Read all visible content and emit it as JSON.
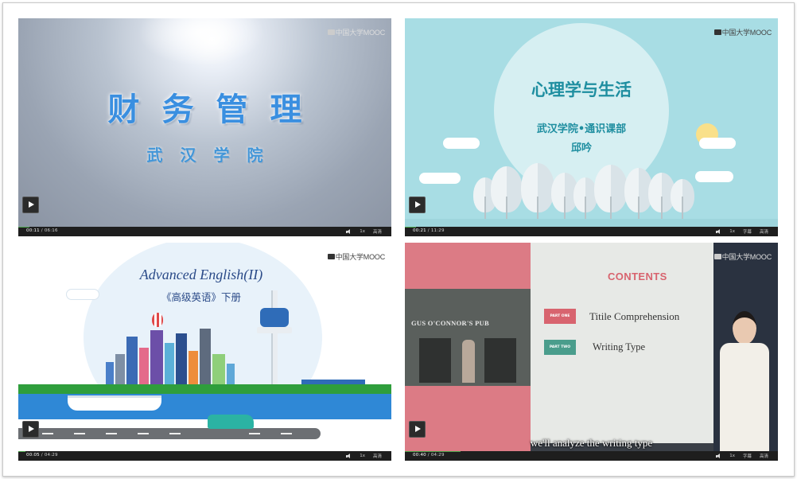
{
  "brand": "中国大学MOOC",
  "players": [
    {
      "title": "财务管理",
      "subtitle": "武汉学院",
      "current_time": "00:11",
      "duration": "06:16",
      "speed": "1x",
      "quality": "高清",
      "progress": 0.03
    },
    {
      "title": "心理学与生活",
      "subtitle": "武汉学院•通识课部",
      "lecturer": "邱吟",
      "current_time": "00:21",
      "duration": "11:29",
      "speed": "1x",
      "captions": "字幕",
      "quality": "高清",
      "progress": 0.03
    },
    {
      "title": "Advanced English(II)",
      "subtitle": "《高级英语》下册",
      "current_time": "00:05",
      "duration": "04:29",
      "speed": "1x",
      "quality": "高清",
      "progress": 0.02
    },
    {
      "slide_heading": "CONTENTS",
      "parts": [
        {
          "tag": "PART ONE",
          "text": "Titile Comprehension",
          "color": "#d8646f"
        },
        {
          "tag": "PART TWO",
          "text": "Writing Type",
          "color": "#4a9d8c"
        }
      ],
      "pub_sign": "GUS O'CONNOR'S PUB",
      "caption": "we'll analyze the writing type",
      "current_time": "00:40",
      "duration": "04:29",
      "speed": "1x",
      "captions": "字幕",
      "quality": "高清",
      "progress": 0.15
    }
  ]
}
